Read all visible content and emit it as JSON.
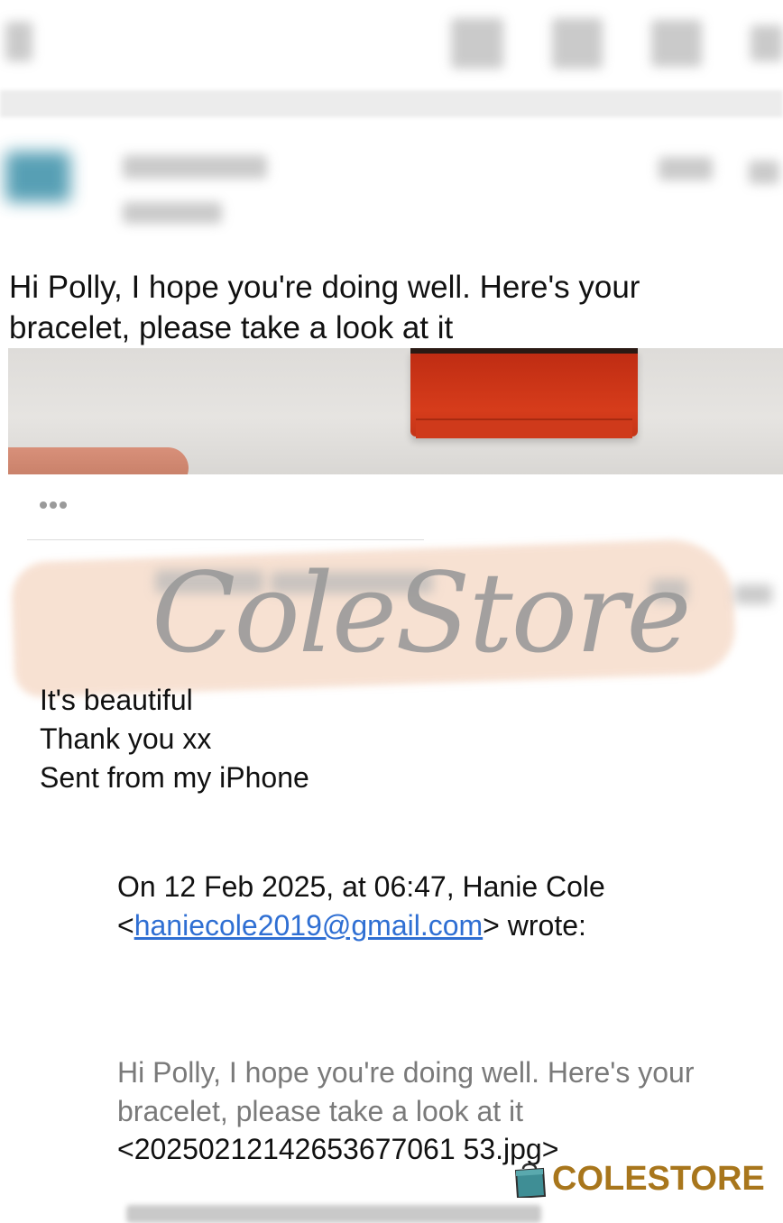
{
  "message1": {
    "body": "Hi Polly, I hope you're doing well. Here's your bracelet, please take a look at it"
  },
  "message2": {
    "lines": [
      "It's beautiful",
      "Thank you xx",
      "Sent from my iPhone"
    ]
  },
  "quote": {
    "header_prefix": "On 12 Feb 2025, at 06:47, Hanie Cole <",
    "email": "haniecole2019@gmail.com",
    "header_suffix": "> wrote:",
    "body": "Hi Polly, I hope you're doing well. Here's your bracelet, please take a look at it",
    "attachment": "<20250212142653677061 53.jpg>"
  },
  "watermark": {
    "text": "ColeStore"
  },
  "brand": {
    "name": "COLESTORE",
    "color": "#a8761c"
  },
  "colors": {
    "link": "#2f6fd3",
    "quote_text": "#7a7a7a",
    "box": "#d63c1b"
  },
  "icons": [
    "back-icon",
    "archive-icon",
    "delete-icon",
    "mail-icon",
    "more-icon",
    "ellipsis-icon",
    "shopping-bag-icon"
  ]
}
